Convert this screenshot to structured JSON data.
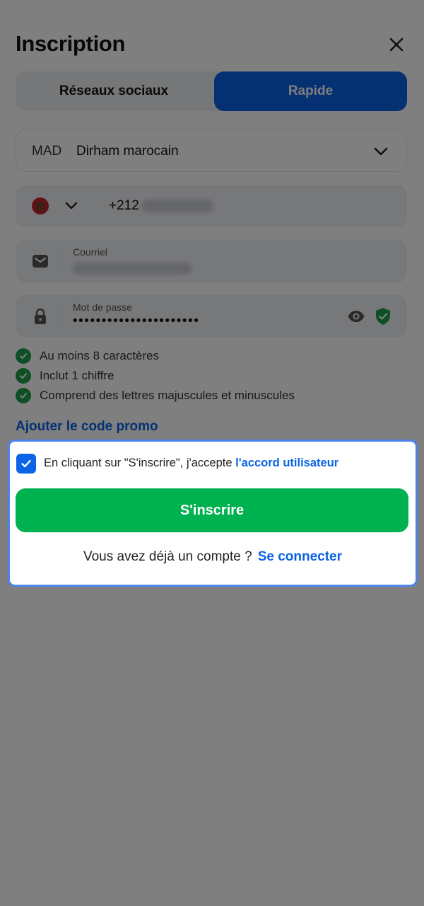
{
  "header": {
    "title": "Inscription",
    "close_icon": "close-icon"
  },
  "tabs": [
    {
      "label": "Réseaux sociaux",
      "active": false
    },
    {
      "label": "Rapide",
      "active": true
    }
  ],
  "currency": {
    "code": "MAD",
    "name": "Dirham marocain"
  },
  "phone": {
    "prefix": "+212"
  },
  "email": {
    "label": "Courriel"
  },
  "password": {
    "label": "Mot de passe",
    "value": "••••••••••••••••••••••"
  },
  "rules": [
    {
      "text": "Au moins 8 caractères"
    },
    {
      "text": "Inclut 1 chiffre"
    },
    {
      "text": "Comprend des lettres majuscules et minuscules"
    }
  ],
  "promo_link": "Ajouter le code promo",
  "card": {
    "agree_prefix": "En cliquant sur \"S'inscrire\", j'accepte ",
    "agree_link": "l'accord utilisateur",
    "submit": "S'inscrire",
    "have_account": "Vous avez déjà un compte ?",
    "login_link": "Se connecter"
  },
  "colors": {
    "accent": "#0b63e5",
    "success": "#00b14f",
    "check": "#1e9e4a",
    "highlight_border": "#4e82ec"
  }
}
